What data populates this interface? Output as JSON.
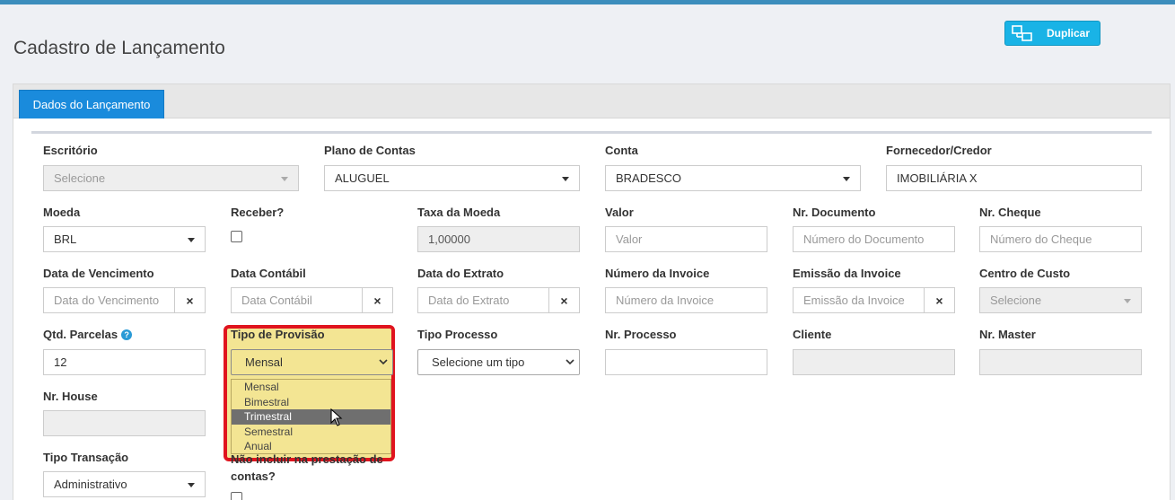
{
  "page": {
    "title": "Cadastro de Lançamento",
    "duplicate_label": "Duplicar"
  },
  "tabs": [
    {
      "label": "Dados do Lançamento"
    }
  ],
  "row1": {
    "escritorio": {
      "label": "Escritório",
      "value": "Selecione"
    },
    "plano": {
      "label": "Plano de Contas",
      "value": "ALUGUEL"
    },
    "conta": {
      "label": "Conta",
      "value": "BRADESCO"
    },
    "fornecedor": {
      "label": "Fornecedor/Credor",
      "value": "IMOBILIÁRIA X"
    }
  },
  "row2": {
    "moeda": {
      "label": "Moeda",
      "value": "BRL"
    },
    "receber": {
      "label": "Receber?",
      "checked": false
    },
    "taxa": {
      "label": "Taxa da Moeda",
      "value": "1,00000"
    },
    "valor": {
      "label": "Valor",
      "placeholder": "Valor"
    },
    "nr_documento": {
      "label": "Nr. Documento",
      "placeholder": "Número do Documento"
    },
    "nr_cheque": {
      "label": "Nr. Cheque",
      "placeholder": "Número do Cheque"
    }
  },
  "row3": {
    "vencimento": {
      "label": "Data de Vencimento",
      "placeholder": "Data do Vencimento"
    },
    "contabil": {
      "label": "Data Contábil",
      "placeholder": "Data Contábil"
    },
    "extrato": {
      "label": "Data do Extrato",
      "placeholder": "Data do Extrato"
    },
    "invoice": {
      "label": "Número da Invoice",
      "placeholder": "Número da Invoice"
    },
    "emissao": {
      "label": "Emissão da Invoice",
      "placeholder": "Emissão da Invoice"
    },
    "centro_custo": {
      "label": "Centro de Custo",
      "value": "Selecione"
    }
  },
  "row4": {
    "parcelas": {
      "label": "Qtd. Parcelas",
      "help_glyph": "?",
      "value": "12"
    },
    "provisao": {
      "label": "Tipo de Provisão",
      "value": "Mensal",
      "options": [
        "Mensal",
        "Bimestral",
        "Trimestral",
        "Semestral",
        "Anual"
      ],
      "hovered": "Trimestral"
    },
    "processo": {
      "label": "Tipo Processo",
      "value": "Selecione um tipo"
    },
    "nr_processo": {
      "label": "Nr. Processo",
      "value": ""
    },
    "cliente": {
      "label": "Cliente",
      "value": ""
    },
    "nr_master": {
      "label": "Nr. Master",
      "value": ""
    }
  },
  "row5": {
    "nr_house": {
      "label": "Nr. House",
      "value": ""
    }
  },
  "row6": {
    "transacao": {
      "label": "Tipo Transação",
      "value": "Administrativo"
    },
    "nao_incluir": {
      "line1": "Não incluir na prestação de",
      "line2": "contas?",
      "checked": false
    }
  },
  "icons": {
    "clear": "×"
  },
  "colors": {
    "primary": "#1a8bdc",
    "accent": "#19b3e6",
    "highlight_border": "#e0141e",
    "highlight_fill": "#f3e593"
  }
}
